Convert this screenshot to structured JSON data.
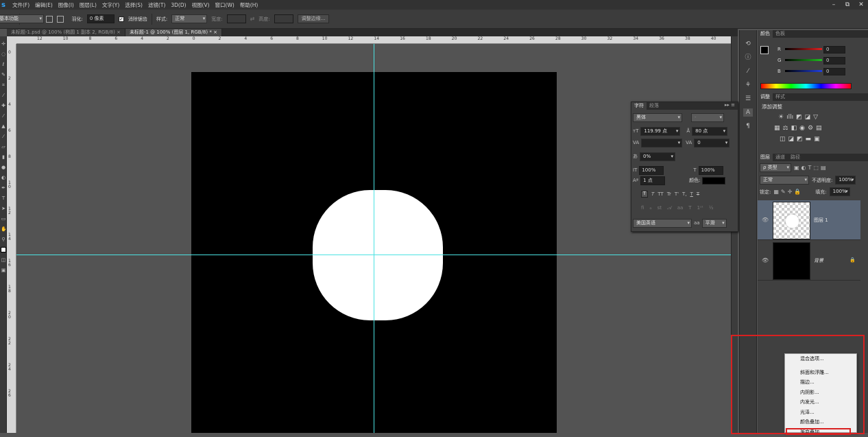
{
  "app_logo": "s",
  "menu": [
    "文件(F)",
    "编辑(E)",
    "图像(I)",
    "图层(L)",
    "文字(Y)",
    "选择(S)",
    "滤镜(T)",
    "3D(D)",
    "视图(V)",
    "窗口(W)",
    "帮助(H)"
  ],
  "window_controls": [
    "–",
    "⧉",
    "✕"
  ],
  "options": {
    "feather_label": "羽化:",
    "feather_value": "0 像素",
    "antialias_label": "消除锯齿",
    "style_label": "样式:",
    "style_value": "正常",
    "width_label": "宽度:",
    "height_label": "高度:",
    "refine_edge": "调整边缘...",
    "workspace": "基本功能"
  },
  "tabs": [
    {
      "label": "未标题-1.psd @ 100% (椭圆 1 副本 2, RGB/8)",
      "close": "×"
    },
    {
      "label": "未标题-1 @ 100% (图层 1, RGB/8) *",
      "close": "×"
    }
  ],
  "hruler_labels": [
    "12",
    "10",
    "8",
    "6",
    "4",
    "2",
    "0",
    "2",
    "4",
    "6",
    "8",
    "10",
    "12",
    "14",
    "16",
    "18",
    "20",
    "22",
    "24",
    "26",
    "28",
    "30",
    "32",
    "34",
    "36",
    "38",
    "40"
  ],
  "vruler_labels": [
    "0",
    "2",
    "4",
    "6",
    "8",
    "1 0",
    "1 2",
    "1 4",
    "1 6",
    "1 8",
    "2 0",
    "2 2",
    "2 4",
    "2 6"
  ],
  "color_panel": {
    "tabs": [
      "颜色",
      "色板"
    ],
    "channels": [
      {
        "name": "R",
        "value": "0",
        "color": "#d02020"
      },
      {
        "name": "G",
        "value": "0",
        "color": "#20c020"
      },
      {
        "name": "B",
        "value": "0",
        "color": "#2040e0"
      }
    ]
  },
  "adjust_panel": {
    "tabs": [
      "调整",
      "样式"
    ],
    "title": "添加调整"
  },
  "layers_panel": {
    "tabs": [
      "图层",
      "通道",
      "路径"
    ],
    "filter_kind": "ρ 类型",
    "blend_mode": "正常",
    "opacity_label": "不透明度:",
    "opacity_value": "100%",
    "lock_label": "锁定:",
    "fill_label": "填充:",
    "fill_value": "100%",
    "layers": [
      {
        "name": "图层 1",
        "selected": true
      },
      {
        "name": "背景",
        "selected": false
      }
    ]
  },
  "char_panel": {
    "tabs": [
      "字符",
      "段落"
    ],
    "font_family": "黑体",
    "font_style": "-",
    "font_size": "119.99 点",
    "leading": "80 点",
    "kerning": "",
    "tracking": "0",
    "tsume": "0%",
    "vscale": "100%",
    "hscale": "100%",
    "baseline": "1 点",
    "color_label": "颜色:",
    "language": "美国英语",
    "aa_label": "aa",
    "aa_value": "平滑",
    "type_buttons": [
      "T",
      "T",
      "TT",
      "Tr",
      "T'",
      "T,",
      "T",
      "T"
    ]
  },
  "context_menu": [
    "混合选项...",
    "斜面和浮雕...",
    "描边...",
    "内阴影...",
    "内发光...",
    "光泽...",
    "颜色叠加...",
    "渐变叠加..."
  ]
}
